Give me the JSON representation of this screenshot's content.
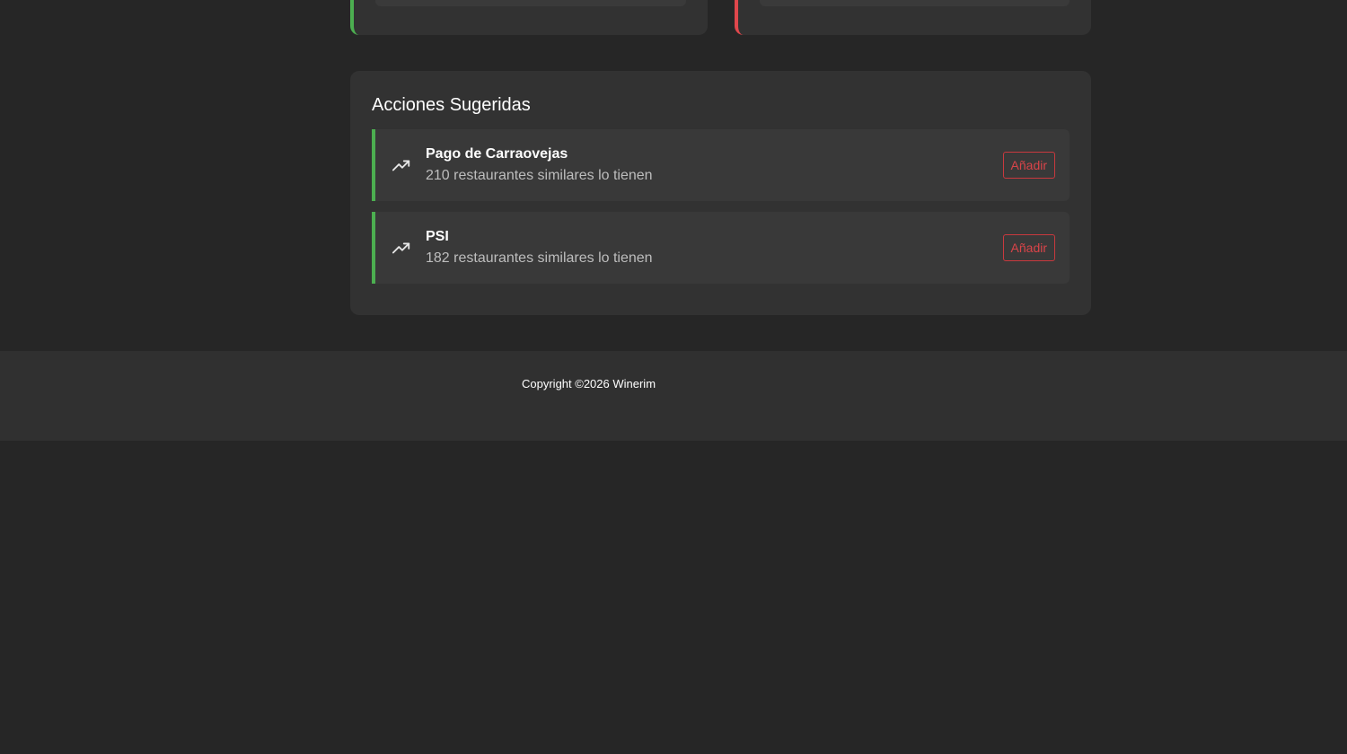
{
  "suggested_actions": {
    "title": "Acciones Sugeridas",
    "items": [
      {
        "name": "Pago de Carraovejas",
        "description": "210 restaurantes similares lo tienen",
        "icon": "trending-up-icon",
        "button_label": "Añadir"
      },
      {
        "name": "PSI",
        "description": "182 restaurantes similares lo tienen",
        "icon": "trending-up-icon",
        "button_label": "Añadir"
      }
    ]
  },
  "footer": {
    "copyright": "Copyright ©2026 Winerim"
  },
  "colors": {
    "background": "#262626",
    "card": "#323232",
    "positive_accent": "#4caf50",
    "negative_accent": "#e0474c",
    "button_accent": "#d94449"
  }
}
